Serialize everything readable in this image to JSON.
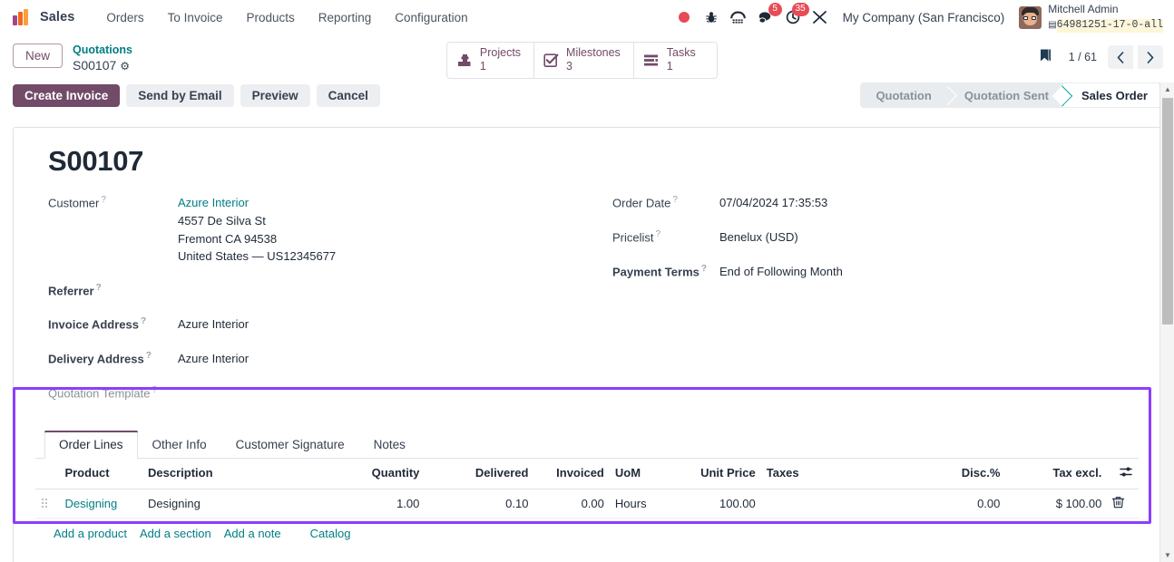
{
  "navbar": {
    "brand": "sales-logo",
    "app_name": "Sales",
    "menu": [
      "Orders",
      "To Invoice",
      "Products",
      "Reporting",
      "Configuration"
    ],
    "systray": [
      {
        "name": "recording-indicator-icon",
        "badge": ""
      },
      {
        "name": "bug-icon",
        "badge": ""
      },
      {
        "name": "voip-dialpad-icon",
        "badge": ""
      },
      {
        "name": "messages-icon",
        "badge": "5"
      },
      {
        "name": "activities-clock-icon",
        "badge": "35"
      },
      {
        "name": "shortcuts-icon",
        "badge": ""
      }
    ],
    "company": "My Company (San Francisco)",
    "user_name": "Mitchell Admin",
    "user_db": "64981251-17-0-all"
  },
  "control_panel": {
    "new_button": "New",
    "breadcrumb_parent": "Quotations",
    "breadcrumb_current": "S00107",
    "smart_buttons": [
      {
        "label": "Projects",
        "value": "1",
        "icon": "projects-icon"
      },
      {
        "label": "Milestones",
        "value": "3",
        "icon": "milestones-check-icon"
      },
      {
        "label": "Tasks",
        "value": "1",
        "icon": "tasks-list-icon"
      }
    ],
    "pager": "1 / 61",
    "prev_icon": "chevron-left-icon",
    "next_icon": "chevron-right-icon",
    "bookmark_icon": "bookmark-icon"
  },
  "actions": {
    "create_invoice": "Create Invoice",
    "send_by_email": "Send by Email",
    "preview": "Preview",
    "cancel": "Cancel"
  },
  "statusbar": {
    "steps": [
      "Quotation",
      "Quotation Sent",
      "Sales Order"
    ],
    "active": "Sales Order",
    "active_color": "#00a09d"
  },
  "record": {
    "title": "S00107",
    "left_fields": [
      {
        "label": "Customer",
        "bold": false,
        "muted": false,
        "link": "Azure Interior",
        "lines": [
          "4557 De Silva St",
          "Fremont CA 94538",
          "United States — US12345677"
        ]
      },
      {
        "label": "Referrer",
        "bold": true,
        "muted": false,
        "value": ""
      },
      {
        "label": "Invoice Address",
        "bold": true,
        "muted": false,
        "value": "Azure Interior"
      },
      {
        "label": "Delivery Address",
        "bold": true,
        "muted": false,
        "value": "Azure Interior"
      },
      {
        "label": "Quotation Template",
        "bold": false,
        "muted": true,
        "value": ""
      }
    ],
    "right_fields": [
      {
        "label": "Order Date",
        "bold": false,
        "value": "07/04/2024 17:35:53"
      },
      {
        "label": "Pricelist",
        "bold": false,
        "value": "Benelux (USD)"
      },
      {
        "label": "Payment Terms",
        "bold": true,
        "value": "End of Following Month"
      }
    ]
  },
  "notebook": {
    "tabs": [
      "Order Lines",
      "Other Info",
      "Customer Signature",
      "Notes"
    ],
    "active_tab": "Order Lines"
  },
  "lines_table": {
    "columns": [
      "Product",
      "Description",
      "Quantity",
      "Delivered",
      "Invoiced",
      "UoM",
      "Unit Price",
      "Taxes",
      "Disc.%",
      "Tax excl."
    ],
    "optional_columns_icon": "column-options-icon",
    "rows": [
      {
        "handle": "drag-handle-icon",
        "product": "Designing",
        "description": "Designing",
        "quantity": "1.00",
        "delivered": "0.10",
        "invoiced": "0.00",
        "uom": "Hours",
        "unit_price": "100.00",
        "taxes": "",
        "discount": "0.00",
        "tax_excl": "$ 100.00",
        "delete_icon": "trash-icon"
      }
    ],
    "add_links": [
      "Add a product",
      "Add a section",
      "Add a note",
      "Catalog"
    ]
  },
  "highlight": {
    "color": "#8b3dff"
  },
  "scrollbar": {
    "up_icon": "scroll-up-arrow",
    "down_icon": "scroll-down-arrow"
  }
}
